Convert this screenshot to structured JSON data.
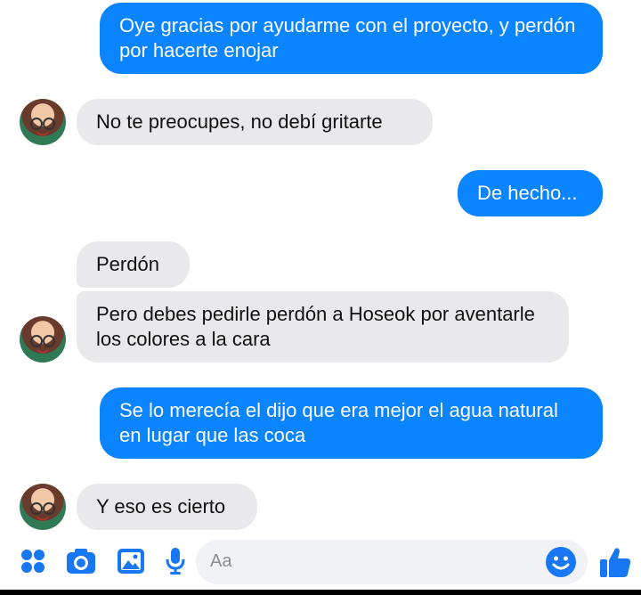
{
  "messages": [
    {
      "side": "out",
      "text": "Oye gracias por ayudarme con el proyecto, y perdón por hacerte enojar"
    },
    {
      "side": "in",
      "text": "No te preocupes, no debí gritarte"
    },
    {
      "side": "out",
      "text": "De hecho..."
    },
    {
      "side": "in",
      "text": "Perdón"
    },
    {
      "side": "in",
      "text": "Pero debes pedirle perdón a Hoseok por aventarle los colores a la cara"
    },
    {
      "side": "out",
      "text": "Se lo merecía el dijo que era mejor el agua natural en lugar que las coca"
    },
    {
      "side": "in",
      "text": "Y eso es cierto"
    }
  ],
  "composer": {
    "placeholder": "Aa",
    "icons": [
      "apps-icon",
      "camera-icon",
      "gallery-icon",
      "microphone-icon",
      "emoji-icon",
      "thumbs-up-icon"
    ]
  },
  "colors": {
    "outgoing": "#0a84ff",
    "incoming": "#e9e9eb",
    "accent": "#1877f2"
  }
}
